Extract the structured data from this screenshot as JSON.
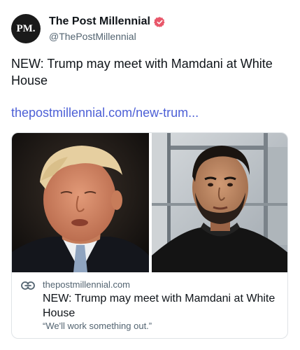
{
  "author": {
    "avatar_text": "PM.",
    "display_name": "The Post Millennial",
    "handle": "@ThePostMillennial",
    "verified": true
  },
  "post": {
    "text": "NEW: Trump may meet with Mamdani at White House",
    "link_text": "thepostmillennial.com/new-trum..."
  },
  "card": {
    "domain": "thepostmillennial.com",
    "title": "NEW: Trump may meet with Mamdani at White House",
    "description": "“We'll work something out.”"
  },
  "colors": {
    "link": "#4c5fd6",
    "verified_badge": "#e8576a",
    "secondary_text": "#536471"
  }
}
